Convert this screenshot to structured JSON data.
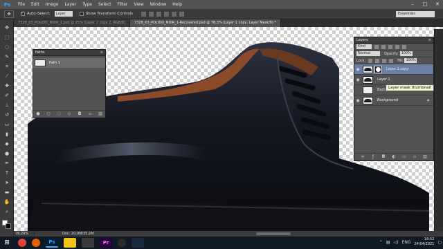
{
  "app": {
    "logo": "Ps"
  },
  "menu": [
    "File",
    "Edit",
    "Image",
    "Layer",
    "Type",
    "Select",
    "Filter",
    "View",
    "Window",
    "Help"
  ],
  "options": {
    "auto_select_label": "Auto-Select:",
    "auto_select_value": "Layer",
    "show_transform_label": "Show Transform Controls",
    "workspace": "Essentials"
  },
  "tabs": [
    {
      "label": "7328_03_POLIDO_NOIR_1.psd @ 25% (Layer 2 copy 2, RGB/8)",
      "active": false
    },
    {
      "label": "7328_03_POLIDO_NOIR_1-Recovered.psd @ 78,3% (Layer 1 copy, Layer Mask/8) *",
      "active": true
    }
  ],
  "status": {
    "zoom": "78,29%",
    "doc": "Doc: 20,0M/35,2M"
  },
  "paths_panel": {
    "title": "Paths",
    "items": [
      {
        "name": "Path 1"
      }
    ]
  },
  "layers_panel": {
    "title": "Layers",
    "kind_label": "Kind",
    "blend_mode": "Normal",
    "opacity_label": "Opacity:",
    "opacity_value": "100%",
    "lock_label": "Lock:",
    "fill_label": "Fill:",
    "fill_value": "100%",
    "layers": [
      {
        "name": "Layer 1 copy",
        "selected": true,
        "has_mask": true,
        "visible": true
      },
      {
        "name": "Layer 1",
        "selected": false,
        "has_mask": false,
        "visible": true
      },
      {
        "name": "Background copy",
        "selected": false,
        "has_mask": false,
        "visible": false
      },
      {
        "name": "Background",
        "selected": false,
        "has_mask": false,
        "visible": true,
        "italic": true,
        "locked": true
      }
    ],
    "tooltip": "Layer mask thumbnail"
  },
  "taskbar": {
    "apps": [
      {
        "name": "chrome",
        "label": "",
        "color": "#db4437"
      },
      {
        "name": "firefox",
        "label": "",
        "color": "#e66000"
      },
      {
        "name": "photoshop",
        "label": "Ps",
        "color": "#001e36",
        "active": true
      },
      {
        "name": "file-explorer",
        "label": "",
        "color": "#f0c419"
      },
      {
        "name": "media-player",
        "label": "",
        "color": "#3a3a3a"
      },
      {
        "name": "premiere",
        "label": "Pr",
        "color": "#2a003f"
      },
      {
        "name": "obs",
        "label": "",
        "color": "#2b2b2b"
      },
      {
        "name": "vegas",
        "label": "",
        "color": "#1a2a3a"
      }
    ],
    "lang": "ENG",
    "time": "18:52",
    "date": "24/04/2021"
  },
  "colors": {
    "accent": "#31a8ff",
    "panel": "#535353",
    "selected_layer": "#6a7fa6"
  }
}
